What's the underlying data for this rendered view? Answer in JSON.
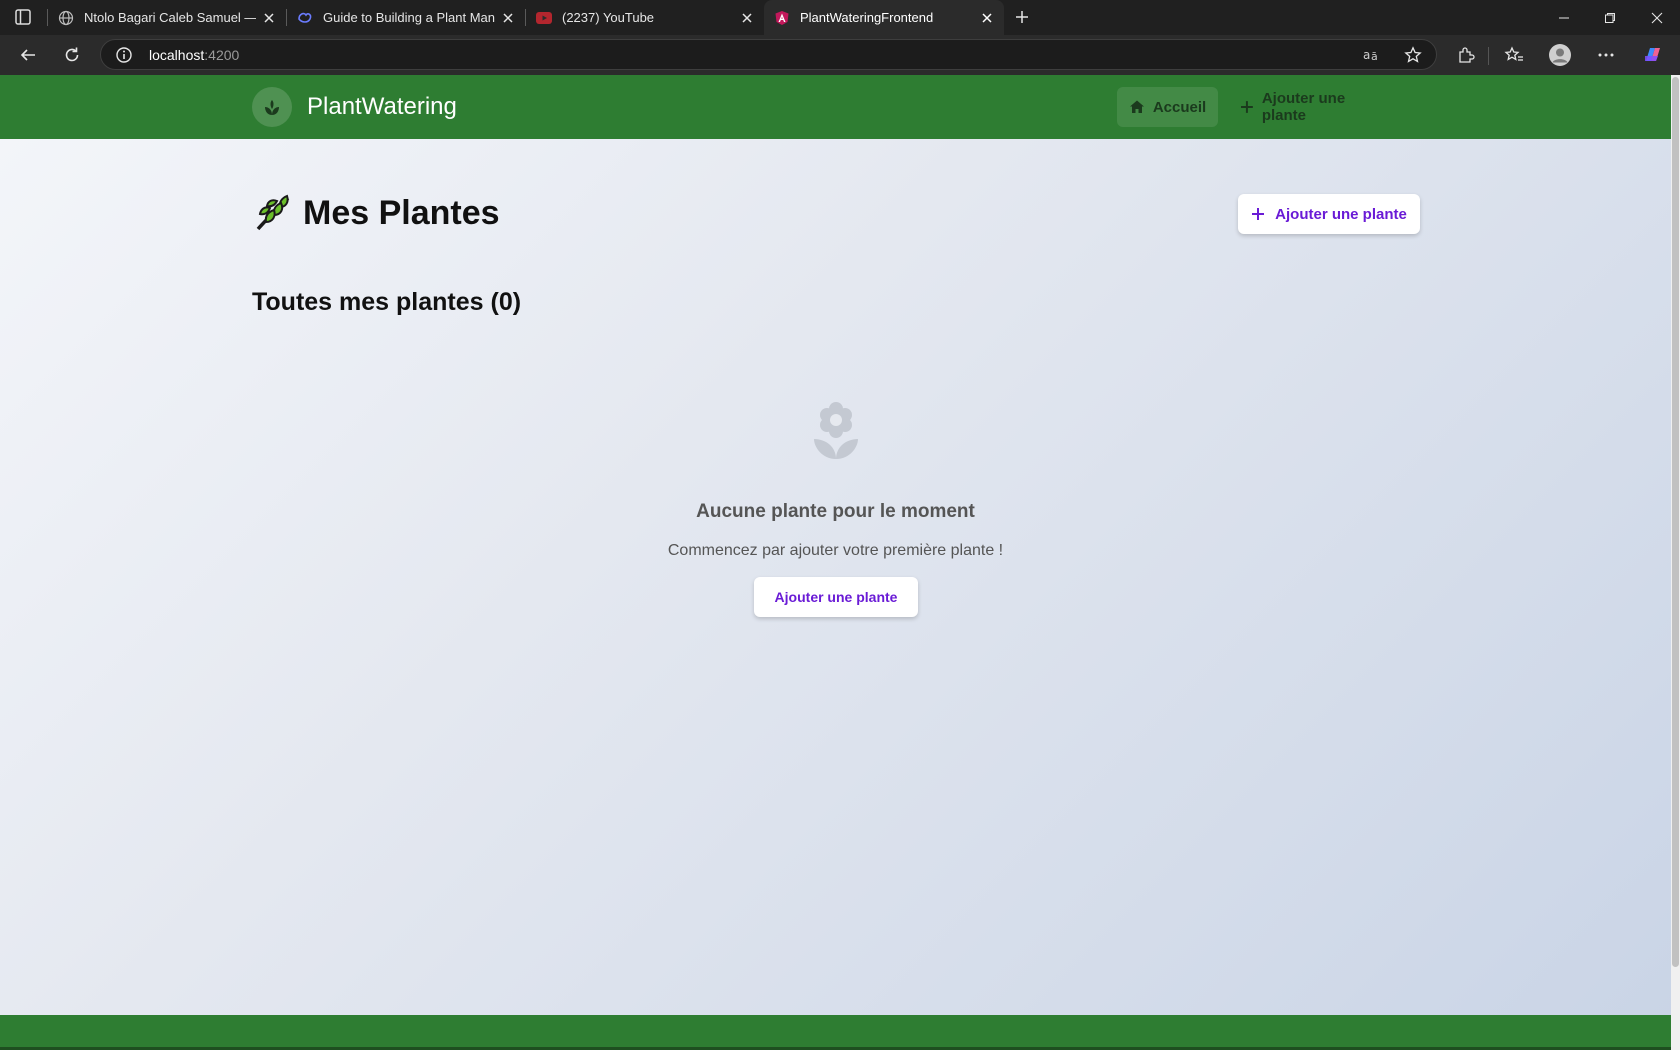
{
  "browser": {
    "tabs": [
      {
        "title": "Ntolo Bagari Caleb Samuel — Por",
        "icon": "globe-icon",
        "active": false
      },
      {
        "title": "Guide to Building a Plant Manage",
        "icon": "ai-assistant-icon",
        "active": false
      },
      {
        "title": "(2237) YouTube",
        "icon": "youtube-icon",
        "active": false
      },
      {
        "title": "PlantWateringFrontend",
        "icon": "angular-icon",
        "active": true
      }
    ],
    "address": {
      "host": "localhost",
      "port": ":4200"
    },
    "colors": {
      "tabstrip": "#202020",
      "toolbar": "#2b2b2b"
    }
  },
  "app": {
    "brand": "PlantWatering",
    "nav": {
      "home": "Accueil",
      "add": "Ajouter une plante"
    },
    "page_title": "Mes Plantes",
    "add_button": "Ajouter une plante",
    "section_title": "Toutes mes plantes (0)",
    "empty": {
      "title": "Aucune plante pour le moment",
      "subtitle": "Commencez par ajouter votre première plante !",
      "button": "Ajouter une plante",
      "icon": "flower-icon"
    },
    "colors": {
      "primary": "#2e7d32",
      "accent": "#6a1bd6",
      "text": "#111111",
      "muted": "#555555"
    }
  }
}
